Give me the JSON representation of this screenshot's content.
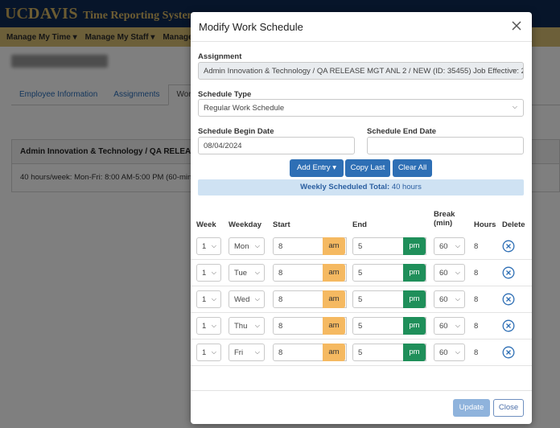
{
  "app": {
    "brand_uc": "UC",
    "brand_davis": "DAVIS",
    "brand_system": "Time Reporting System",
    "nav": [
      {
        "label": "Manage My Time ▾"
      },
      {
        "label": "Manage My Staff ▾"
      },
      {
        "label": "Manage"
      }
    ],
    "tabs": [
      {
        "label": "Employee Information"
      },
      {
        "label": "Assignments"
      },
      {
        "label": "Work S"
      }
    ],
    "assignment_card_title": "Admin Innovation & Technology / QA RELEASE MG",
    "assignment_card_schedule": "40 hours/week: Mon-Fri: 8:00 AM-5:00 PM (60-min"
  },
  "modal": {
    "title": "Modify Work Schedule",
    "assignment_label": "Assignment",
    "assignment_value": "Admin Innovation & Technology / QA RELEASE MGT ANL 2 / NEW (ID: 35455) Job Effective: 2",
    "schedule_type_label": "Schedule Type",
    "schedule_type_value": "Regular Work Schedule",
    "begin_date_label": "Schedule Begin Date",
    "begin_date_value": "08/04/2024",
    "end_date_label": "Schedule End Date",
    "end_date_value": "",
    "add_entry_label": "Add Entry ▾",
    "copy_last_label": "Copy Last",
    "clear_all_label": "Clear All",
    "total_label": "Weekly Scheduled Total:",
    "total_value": "40 hours",
    "columns": {
      "week": "Week",
      "weekday": "Weekday",
      "start": "Start",
      "end": "End",
      "break_line1": "Break",
      "break_line2": "(min)",
      "hours": "Hours",
      "delete": "Delete"
    },
    "rows": [
      {
        "week": "1",
        "weekday": "Mon",
        "start": "8",
        "start_ampm": "am",
        "end": "5",
        "end_ampm": "pm",
        "break": "60",
        "hours": "8"
      },
      {
        "week": "1",
        "weekday": "Tue",
        "start": "8",
        "start_ampm": "am",
        "end": "5",
        "end_ampm": "pm",
        "break": "60",
        "hours": "8"
      },
      {
        "week": "1",
        "weekday": "Wed",
        "start": "8",
        "start_ampm": "am",
        "end": "5",
        "end_ampm": "pm",
        "break": "60",
        "hours": "8"
      },
      {
        "week": "1",
        "weekday": "Thu",
        "start": "8",
        "start_ampm": "am",
        "end": "5",
        "end_ampm": "pm",
        "break": "60",
        "hours": "8"
      },
      {
        "week": "1",
        "weekday": "Fri",
        "start": "8",
        "start_ampm": "am",
        "end": "5",
        "end_ampm": "pm",
        "break": "60",
        "hours": "8"
      }
    ],
    "update_label": "Update",
    "close_label": "Close"
  },
  "colors": {
    "header_navy": "#0f2a54",
    "nav_gold": "#d8bf73",
    "primary_blue": "#2e6fb5",
    "am_orange": "#f5b961",
    "pm_green": "#1f8f5a"
  }
}
